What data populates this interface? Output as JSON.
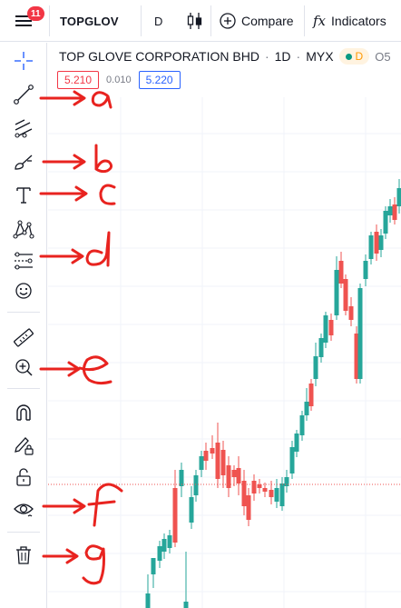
{
  "topbar": {
    "notifications_count": "11",
    "symbol": "TOPGLOV",
    "interval": "D",
    "compare_label": "Compare",
    "indicators_label": "Indicators",
    "indicators_icon": "fx"
  },
  "legend": {
    "title": "TOP GLOVE CORPORATION BHD",
    "interval": "1D",
    "exchange": "MYX",
    "separator": "·",
    "market_status": "D",
    "ohlc_prefix": "O5"
  },
  "quotes": {
    "bid": "5.210",
    "spread": "0.010",
    "ask": "5.220"
  },
  "tools": [
    {
      "name": "crosshair-tool",
      "icon": "crosshair-icon"
    },
    {
      "name": "trend-line-tool",
      "icon": "trend-line-icon",
      "annotation": "a"
    },
    {
      "name": "fib-tool",
      "icon": "fib-retracement-icon"
    },
    {
      "name": "brush-tool",
      "icon": "brush-icon",
      "annotation": "b"
    },
    {
      "name": "text-tool",
      "icon": "text-icon",
      "annotation": "c"
    },
    {
      "name": "pattern-tool",
      "icon": "pattern-icon"
    },
    {
      "name": "prediction-tool",
      "icon": "long-position-icon",
      "annotation": "d"
    },
    {
      "name": "emoji-tool",
      "icon": "smiley-icon"
    },
    {
      "name": "measure-tool",
      "icon": "ruler-icon"
    },
    {
      "name": "zoom-tool",
      "icon": "zoom-in-icon",
      "annotation": "e"
    },
    {
      "name": "magnet-tool",
      "icon": "magnet-icon"
    },
    {
      "name": "lock-drawings-tool",
      "icon": "pencil-lock-icon"
    },
    {
      "name": "lock-all-tool",
      "icon": "lock-icon"
    },
    {
      "name": "hide-drawings-tool",
      "icon": "eye-icon",
      "annotation": "f"
    },
    {
      "name": "remove-drawings-tool",
      "icon": "trash-icon",
      "annotation": "g"
    }
  ],
  "colors": {
    "up": "#26a69a",
    "down": "#ef5350",
    "annotation": "#e8231f",
    "price_line": "#ef5350"
  }
}
